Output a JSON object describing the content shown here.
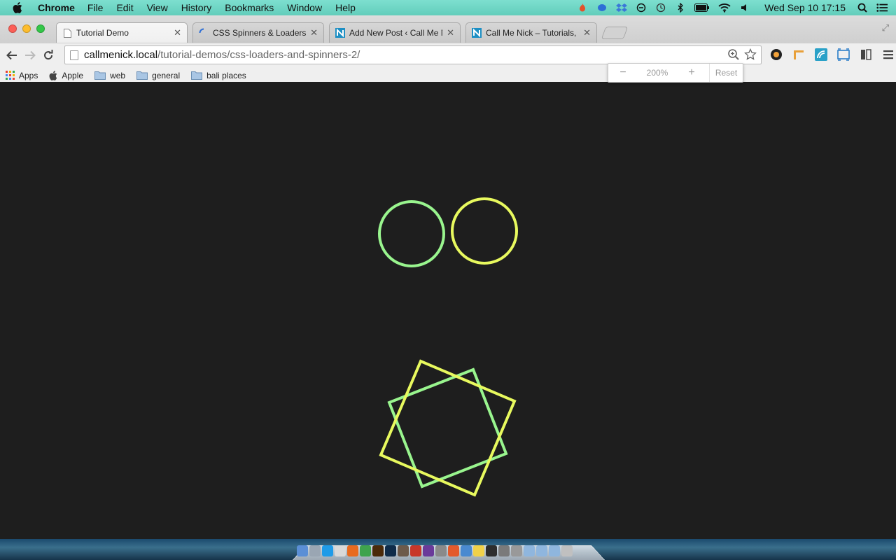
{
  "menubar": {
    "app_name": "Chrome",
    "items": [
      "File",
      "Edit",
      "View",
      "History",
      "Bookmarks",
      "Window",
      "Help"
    ],
    "clock": "Wed Sep 10  17:15",
    "status_icons": [
      "fire-icon",
      "elephant-icon",
      "dropbox-icon",
      "sync-icon",
      "time-machine-icon",
      "bluetooth-icon",
      "battery-icon",
      "wifi-icon",
      "volume-icon"
    ]
  },
  "tabs": [
    {
      "title": "Tutorial Demo",
      "favicon": "page-icon",
      "active": true
    },
    {
      "title": "CSS Spinners & Loaders – C",
      "favicon": "loading-spinner-icon",
      "active": false
    },
    {
      "title": "Add New Post ‹ Call Me Nic",
      "favicon": "callmenick-icon",
      "active": false
    },
    {
      "title": "Call Me Nick – Tutorials, Sn",
      "favicon": "callmenick-icon",
      "active": false
    }
  ],
  "omnibox": {
    "host": "callmenick.local",
    "path": "/tutorial-demos/css-loaders-and-spinners-2/"
  },
  "bookmarks": [
    {
      "label": "Apps",
      "icon": "apps-grid-icon"
    },
    {
      "label": "Apple",
      "icon": "apple-icon"
    },
    {
      "label": "web",
      "icon": "folder-icon"
    },
    {
      "label": "general",
      "icon": "folder-icon"
    },
    {
      "label": "bali places",
      "icon": "folder-icon"
    }
  ],
  "zoom": {
    "minus": "−",
    "level": "200%",
    "plus": "+",
    "reset": "Reset"
  },
  "colors": {
    "page_background": "#1e1e1e",
    "loader_green": "#99f58e",
    "loader_yellow": "#e8f95e"
  },
  "loaders": {
    "circles": [
      "green",
      "yellow"
    ],
    "squares": [
      "green",
      "yellow"
    ]
  }
}
